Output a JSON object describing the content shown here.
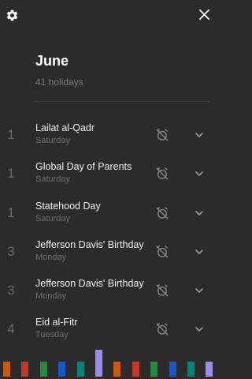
{
  "header": {
    "settings_icon": "gear-icon",
    "close_icon": "close-icon"
  },
  "month": {
    "title": "June",
    "subtitle": "41 holidays"
  },
  "holidays": [
    {
      "day": "1",
      "name": "Lailat al-Qadr",
      "weekday": "Saturday"
    },
    {
      "day": "1",
      "name": "Global Day of Parents",
      "weekday": "Saturday"
    },
    {
      "day": "1",
      "name": "Statehood Day",
      "weekday": "Saturday"
    },
    {
      "day": "3",
      "name": "Jefferson Davis' Birthday",
      "weekday": "Monday"
    },
    {
      "day": "3",
      "name": "Jefferson Davis' Birthday",
      "weekday": "Monday"
    },
    {
      "day": "4",
      "name": "Eid al-Fitr",
      "weekday": "Tuesday"
    }
  ],
  "month_bars": [
    {
      "color": "#c85a14",
      "level": 0.55
    },
    {
      "color": "#c0392b",
      "level": 0.55
    },
    {
      "color": "#1e8e3e",
      "level": 0.55
    },
    {
      "color": "#1a56c4",
      "level": 0.55
    },
    {
      "color": "#0b8178",
      "level": 0.55
    },
    {
      "color": "#9b8cf2",
      "level": 1.0
    },
    {
      "color": "#c85a14",
      "level": 0.55
    },
    {
      "color": "#c0392b",
      "level": 0.55
    },
    {
      "color": "#1e8e3e",
      "level": 0.55
    },
    {
      "color": "#1a56c4",
      "level": 0.55
    },
    {
      "color": "#0b8178",
      "level": 0.55
    },
    {
      "color": "#9b8cf2",
      "level": 0.55
    }
  ]
}
